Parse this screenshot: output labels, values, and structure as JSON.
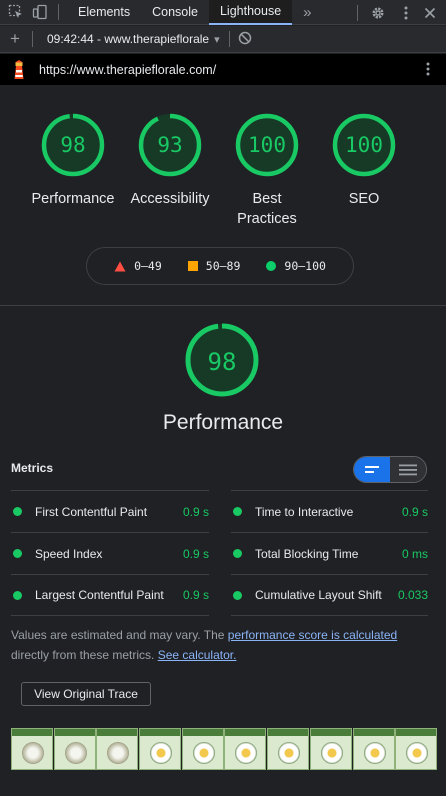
{
  "devtools": {
    "tabs": [
      "Elements",
      "Console",
      "Lighthouse"
    ],
    "active_tab": "Lighthouse",
    "more_tabs_glyph": "»",
    "icons": [
      "inspect-element-icon",
      "device-toolbar-icon",
      "gear-icon",
      "kebab-menu-icon",
      "close-icon"
    ]
  },
  "toolbar": {
    "add_glyph": "+",
    "report_label": "09:42:44 - www.therapieflorale",
    "dropdown_glyph": "▾",
    "icons": [
      "add-icon",
      "dropdown-arrow-icon",
      "clear-icon"
    ]
  },
  "urlbar": {
    "url": "https://www.therapieflorale.com/",
    "icons": [
      "lighthouse-logo-icon",
      "kebab-menu-icon"
    ]
  },
  "scores": [
    {
      "label": "Performance",
      "value": "98",
      "fraction": 0.98
    },
    {
      "label": "Accessibility",
      "value": "93",
      "fraction": 0.93
    },
    {
      "label": "Best Practices",
      "value": "100",
      "fraction": 1.0
    },
    {
      "label": "SEO",
      "value": "100",
      "fraction": 1.0
    }
  ],
  "legend": [
    {
      "label": "0–49",
      "icon": "triangle-icon",
      "color": "#ff4e42"
    },
    {
      "label": "50–89",
      "icon": "square-icon",
      "color": "#ffa400"
    },
    {
      "label": "90–100",
      "icon": "circle-icon",
      "color": "#0cce6b"
    }
  ],
  "performance": {
    "value": "98",
    "fraction": 0.98,
    "title": "Performance"
  },
  "metrics": {
    "header": "Metrics",
    "items": [
      {
        "name": "First Contentful Paint",
        "value": "0.9 s"
      },
      {
        "name": "Time to Interactive",
        "value": "0.9 s"
      },
      {
        "name": "Speed Index",
        "value": "0.9 s"
      },
      {
        "name": "Total Blocking Time",
        "value": "0 ms"
      },
      {
        "name": "Largest Contentful Paint",
        "value": "0.9 s"
      },
      {
        "name": "Cumulative Layout Shift",
        "value": "0.033"
      }
    ]
  },
  "note": {
    "text1": "Values are estimated and may vary. The ",
    "link1": "performance score is calculated",
    "text2": " directly from these metrics. ",
    "link2": "See calculator."
  },
  "trace_button": "View Original Trace",
  "colors": {
    "pass": "#18c964",
    "accent": "#1a73e8",
    "link": "#8ab4f8",
    "background": "#202124"
  }
}
